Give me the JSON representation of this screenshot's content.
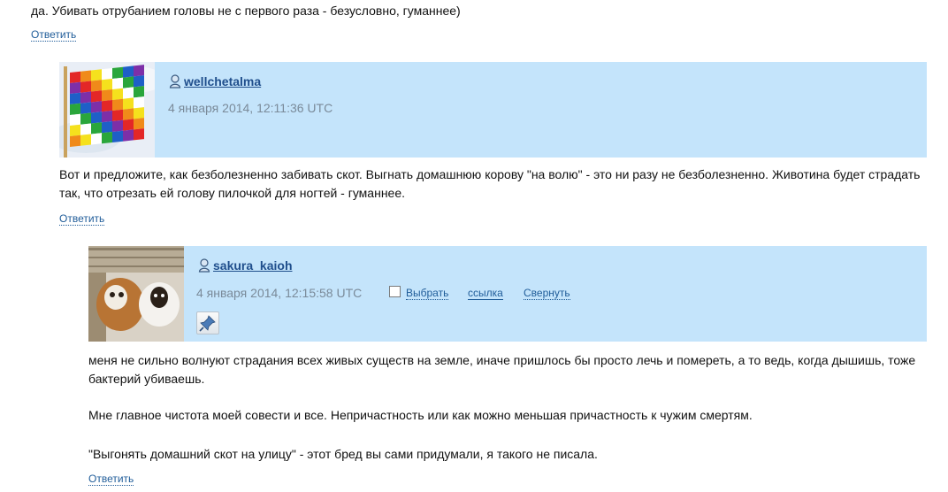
{
  "top": {
    "text": "да. Убивать отрубанием головы не с первого раза - безусловно, гуманнее)",
    "reply": "Ответить"
  },
  "comments": [
    {
      "username": "wellchetalma",
      "date": "4 января 2014, 12:11:36 UTC",
      "body": "Вот и предложите, как безболезненно забивать скот. Выгнать домашнюю корову \"на волю\" - это ни разу не безболезненно. Животина будет страдать так, что отрезать ей голову пилочкой для ногтей - гуманнее.",
      "reply": "Ответить"
    },
    {
      "username": "sakura_kaioh",
      "date": "4 января 2014, 12:15:58 UTC",
      "select_label": "Выбрать",
      "link_label": "ссылка",
      "collapse_label": "Свернуть",
      "paragraphs": [
        "меня не сильно волнуют страдания всех живых существ на земле, иначе пришлось бы просто лечь и помереть, а то ведь, когда дышишь, тоже бактерий убиваешь.",
        "Мне главное чистота моей совести и все. Непричастность или как можно меньшая причастность к чужим смертям.",
        "\"Выгонять домашний скот на улицу\" - этот бред вы сами придумали, я такого не писала."
      ],
      "reply": "Ответить"
    }
  ],
  "colors": {
    "header_bg": "#c4e4fb",
    "link": "#1f5c99",
    "date": "#7a8a99"
  },
  "icons": {
    "user": "user-icon",
    "pin": "pin-icon"
  }
}
